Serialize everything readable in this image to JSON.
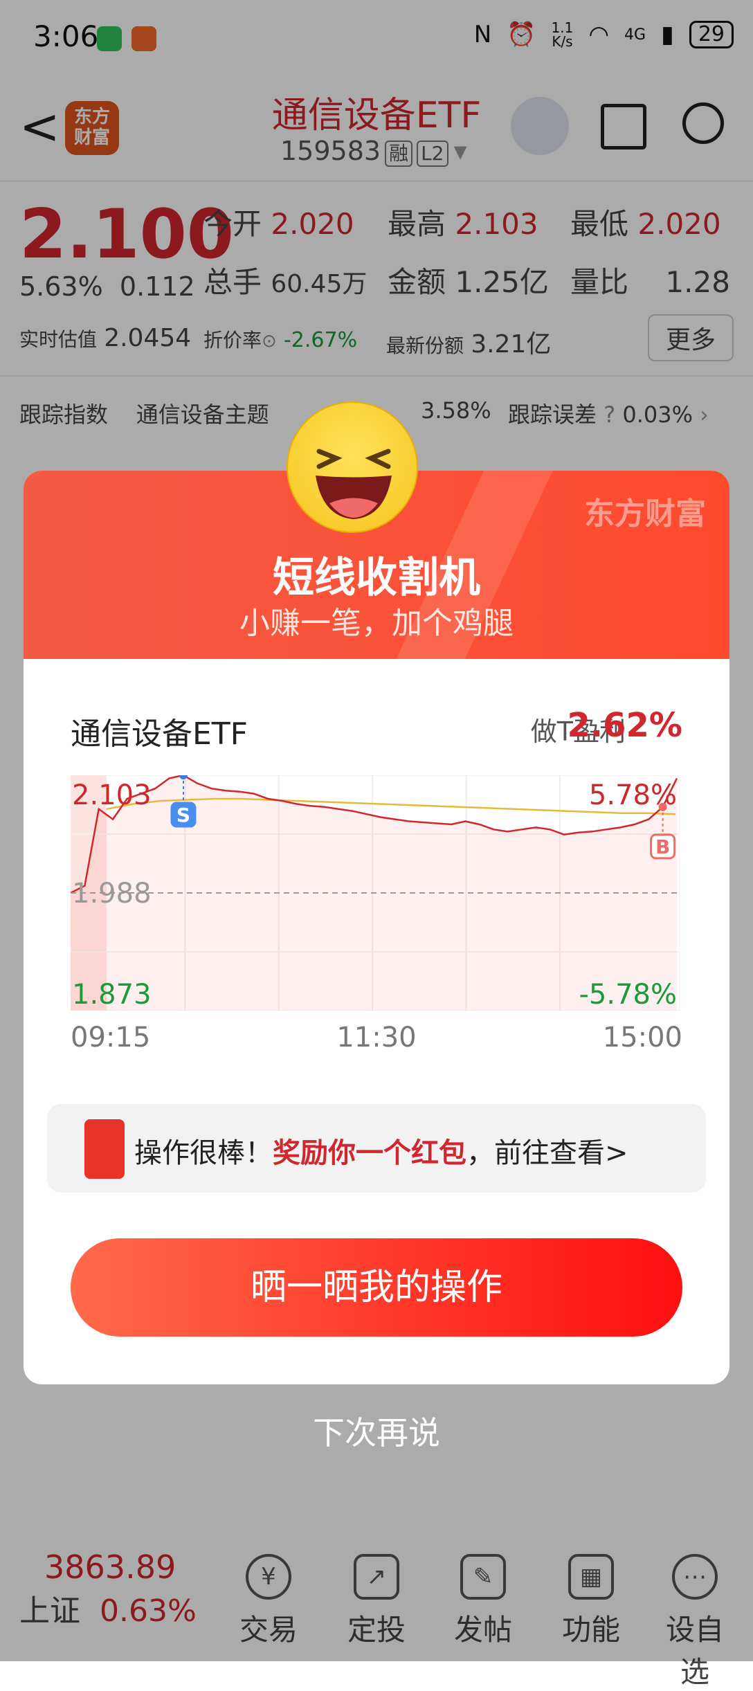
{
  "status": {
    "time": "3:06",
    "speed_top": "1.1",
    "speed_bottom": "K/s",
    "net": "4G",
    "battery": "29"
  },
  "header": {
    "back": "<",
    "logo_line1": "东方",
    "logo_line2": "财富",
    "title": "通信设备ETF",
    "code": "159583",
    "tag1": "融",
    "tag2": "L2"
  },
  "quote": {
    "price": "2.100",
    "change_pct": "5.63%",
    "change": "0.112",
    "open_label": "今开",
    "open": "2.020",
    "high_label": "最高",
    "high": "2.103",
    "low_label": "最低",
    "low": "2.020",
    "vol_label": "总手",
    "vol": "60.45万",
    "amt_label": "金额",
    "amt": "1.25亿",
    "ratio_label": "量比",
    "ratio": "1.28",
    "est_label": "实时估值",
    "est": "2.0454",
    "disc_label": "折价率",
    "disc": "-2.67%",
    "shares_label": "最新份额",
    "shares": "3.21亿",
    "more": "更多",
    "track_label": "跟踪指数",
    "track_name": "通信设备主题",
    "track_pct": "3.58%",
    "err_label": "跟踪误差",
    "err": "0.03%"
  },
  "modal": {
    "brand": "东方财富",
    "title": "短线收割机",
    "subtitle": "小赚一笔，加个鸡腿",
    "chart_title": "通信设备ETF",
    "profit_label": "做T盈利",
    "profit": "2.62%",
    "redpacket_prefix": "操作很棒！",
    "redpacket_highlight": "奖励你一个红包",
    "redpacket_suffix": "，前往查看>",
    "share": "晒一晒我的操作",
    "later": "下次再说"
  },
  "chart_data": {
    "type": "line",
    "x_ticks": [
      "09:15",
      "11:30",
      "15:00"
    ],
    "y_labels_left": [
      "2.103",
      "1.988",
      "1.873"
    ],
    "y_labels_right": [
      "5.78%",
      "-5.78%"
    ],
    "ylim": [
      1.873,
      2.103
    ],
    "base": 1.988,
    "series": [
      {
        "values": [
          1.988,
          1.995,
          2.07,
          2.06,
          2.08,
          2.085,
          2.09,
          2.1,
          2.103,
          2.095,
          2.09,
          2.088,
          2.087,
          2.085,
          2.08,
          2.078,
          2.075,
          2.073,
          2.072,
          2.07,
          2.068,
          2.065,
          2.062,
          2.06,
          2.058,
          2.057,
          2.056,
          2.055,
          2.058,
          2.055,
          2.05,
          2.048,
          2.05,
          2.052,
          2.05,
          2.045,
          2.047,
          2.048,
          2.05,
          2.052,
          2.055,
          2.06,
          2.072,
          2.1
        ]
      },
      {
        "values": [
          2.07,
          2.075,
          2.078,
          2.079,
          2.08,
          2.08,
          2.079,
          2.078,
          2.077,
          2.076,
          2.075,
          2.074,
          2.073,
          2.072,
          2.071,
          2.07,
          2.069,
          2.068,
          2.067,
          2.066,
          2.066,
          2.065
        ]
      }
    ],
    "markers": [
      {
        "label": "S",
        "value": 2.103
      },
      {
        "label": "B",
        "value": 2.072
      }
    ]
  },
  "nav": {
    "index_value": "3863.89",
    "index_name": "上证",
    "index_pct": "0.63%",
    "trade": "交易",
    "plan": "定投",
    "post": "发帖",
    "func": "功能",
    "watch": "设自选"
  }
}
